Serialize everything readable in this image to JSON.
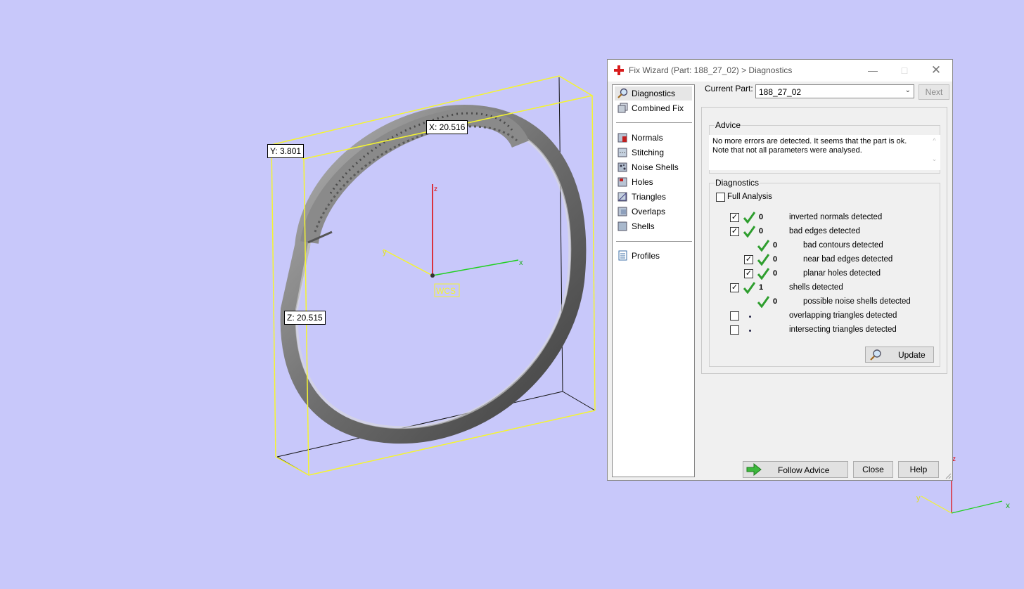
{
  "viewport": {
    "dim_x": "X: 20.516",
    "dim_y": "Y: 3.801",
    "dim_z": "Z: 20.515",
    "axis_z": "z",
    "axis_y": "y",
    "axis_x": "x",
    "wcs": "WCS"
  },
  "dialog": {
    "title": "Fix Wizard (Part: 188_27_02) > Diagnostics",
    "nav": {
      "diagnostics": "Diagnostics",
      "combined_fix": "Combined Fix",
      "normals": "Normals",
      "stitching": "Stitching",
      "noise_shells": "Noise Shells",
      "holes": "Holes",
      "triangles": "Triangles",
      "overlaps": "Overlaps",
      "shells": "Shells",
      "profiles": "Profiles"
    },
    "current_part_label": "Current Part:",
    "current_part_value": "188_27_02",
    "next_label": "Next",
    "advice": {
      "title": "Advice",
      "text_line1": "No more errors are detected. It seems that the part is ok.",
      "text_line2": "Note that not all parameters were analysed."
    },
    "diagnostics": {
      "title": "Diagnostics",
      "full_analysis": "Full Analysis",
      "rows": [
        {
          "count": "0",
          "label": "inverted normals detected"
        },
        {
          "count": "0",
          "label": "bad edges detected"
        },
        {
          "count": "0",
          "label": "bad contours detected"
        },
        {
          "count": "0",
          "label": "near bad edges detected"
        },
        {
          "count": "0",
          "label": "planar holes detected"
        },
        {
          "count": "1",
          "label": "shells detected"
        },
        {
          "count": "0",
          "label": "possible noise shells detected"
        },
        {
          "count": "",
          "label": "overlapping triangles detected"
        },
        {
          "count": "",
          "label": "intersecting triangles detected"
        }
      ],
      "update_label": "Update"
    },
    "follow_advice_label": "Follow Advice",
    "close_label": "Close",
    "help_label": "Help"
  },
  "corner_axis": {
    "z": "z",
    "y": "y",
    "x": "x"
  }
}
